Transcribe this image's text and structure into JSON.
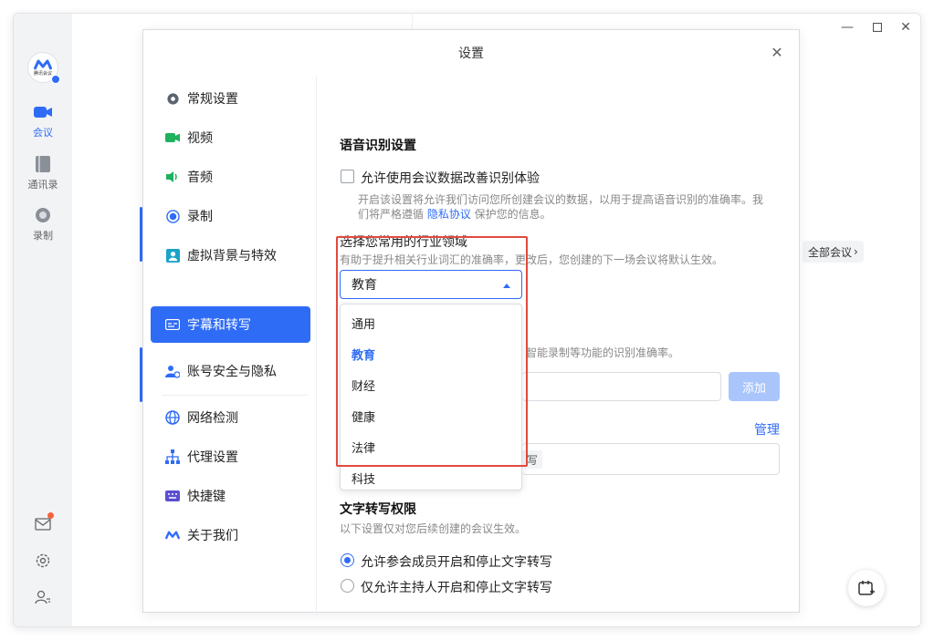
{
  "rail": {
    "logo_text": "腾讯会议",
    "items": [
      {
        "label": "会议",
        "icon": "video-camera-icon",
        "active": true
      },
      {
        "label": "通讯录",
        "icon": "contacts-book-icon",
        "active": false
      },
      {
        "label": "录制",
        "icon": "record-icon",
        "active": false
      }
    ],
    "bottom_icons": [
      "mail-icon",
      "settings-gear-icon",
      "user-switch-icon"
    ]
  },
  "background": {
    "all_meetings_label": "全部会议"
  },
  "dialog": {
    "title": "设置",
    "sidebar": [
      {
        "label": "常规设置",
        "icon": "gear-icon",
        "color": "#5b6370"
      },
      {
        "label": "视频",
        "icon": "video-camera-icon",
        "color": "#1fb15f"
      },
      {
        "label": "音频",
        "icon": "speaker-icon",
        "color": "#1fb15f"
      },
      {
        "label": "录制",
        "icon": "record-icon",
        "color": "#2f6cf6"
      },
      {
        "label": "虚拟背景与特效",
        "icon": "portrait-icon",
        "color": "#1aa3c8"
      },
      {
        "label": "字幕和转写",
        "icon": "caption-icon",
        "color": "#2f6cf6",
        "active": true
      },
      {
        "label": "账号安全与隐私",
        "icon": "user-shield-icon",
        "color": "#2f6cf6"
      },
      {
        "label": "网络检测",
        "icon": "globe-icon",
        "color": "#2f6cf6"
      },
      {
        "label": "代理设置",
        "icon": "network-tree-icon",
        "color": "#2f6cf6"
      },
      {
        "label": "快捷键",
        "icon": "keyboard-icon",
        "color": "#5a4fcf"
      },
      {
        "label": "关于我们",
        "icon": "brand-logo-icon",
        "color": "#2f6cf6"
      }
    ],
    "content": {
      "section1_title": "语音识别设置",
      "checkbox_label": "允许使用会议数据改善识别体验",
      "desc1_line1": "开启该设置将允许我们访问您所创建会议的数据，以用于提高语音识别的准确率。我",
      "desc1_line2_prefix": "们将严格遵循 ",
      "privacy_link": "隐私协议",
      "desc1_line2_suffix": " 保护您的信息。",
      "industry_title": "选择您常用的行业领域",
      "industry_desc": "有助于提升相关行业词汇的准确率，更改后，您创建的下一场会议将默认生效。",
      "select_value": "教育",
      "options": [
        "通用",
        "教育",
        "财经",
        "健康",
        "法律",
        "科技"
      ],
      "selected_option": "教育",
      "partial_desc": "智能录制等功能的识别准确率。",
      "add_button": "添加",
      "manage_link": "管理",
      "tag_partial": "写",
      "section2_title": "文字转写权限",
      "section2_desc": "以下设置仅对您后续创建的会议生效。",
      "radio1_label": "允许参会成员开启和停止文字转写",
      "radio2_label": "仅允许主持人开启和停止文字转写",
      "radio_selected": 1
    }
  }
}
